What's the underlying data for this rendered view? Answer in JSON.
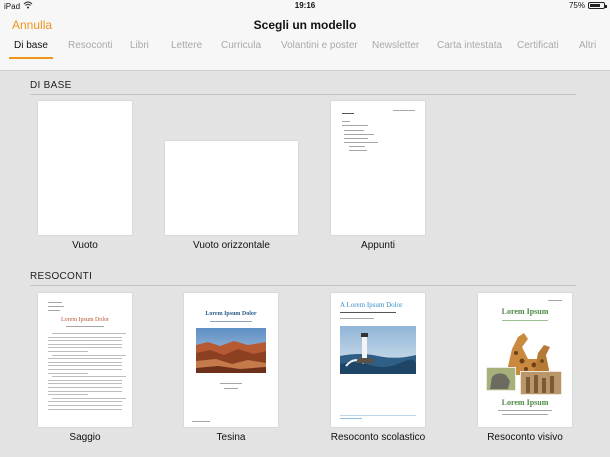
{
  "status_bar": {
    "device": "iPad",
    "time": "19:16",
    "battery": "75%",
    "battery_level": 0.75
  },
  "header": {
    "cancel_label": "Annulla",
    "title": "Scegli un modello"
  },
  "tabs": [
    "Di base",
    "Resoconti",
    "Libri",
    "Lettere",
    "Curricula",
    "Volantini e poster",
    "Newsletter",
    "Carta intestata",
    "Certificati",
    "Altri"
  ],
  "active_tab": "Di base",
  "colors": {
    "accent": "#f0941a",
    "inactive_tab": "#a9a9a9",
    "background": "#e3e3e3"
  },
  "sections": [
    {
      "label": "DI BASE",
      "templates": [
        "Vuoto",
        "Vuoto orizzontale",
        "Appunti"
      ]
    },
    {
      "label": "RESOCONTI",
      "templates": [
        "Saggio",
        "Tesina",
        "Resoconto scolastico",
        "Resoconto visivo"
      ]
    }
  ],
  "thumbnails": {
    "saggio_title": "Lorem Ipsum Dolor",
    "tesina_title": "Lorem Ipsum Dolor",
    "scolastico_title": "A Lorem Ipsum Dolor",
    "visivo_title": "Lorem Ipsum",
    "visivo_subtitle": "Lorem Ipsum"
  }
}
